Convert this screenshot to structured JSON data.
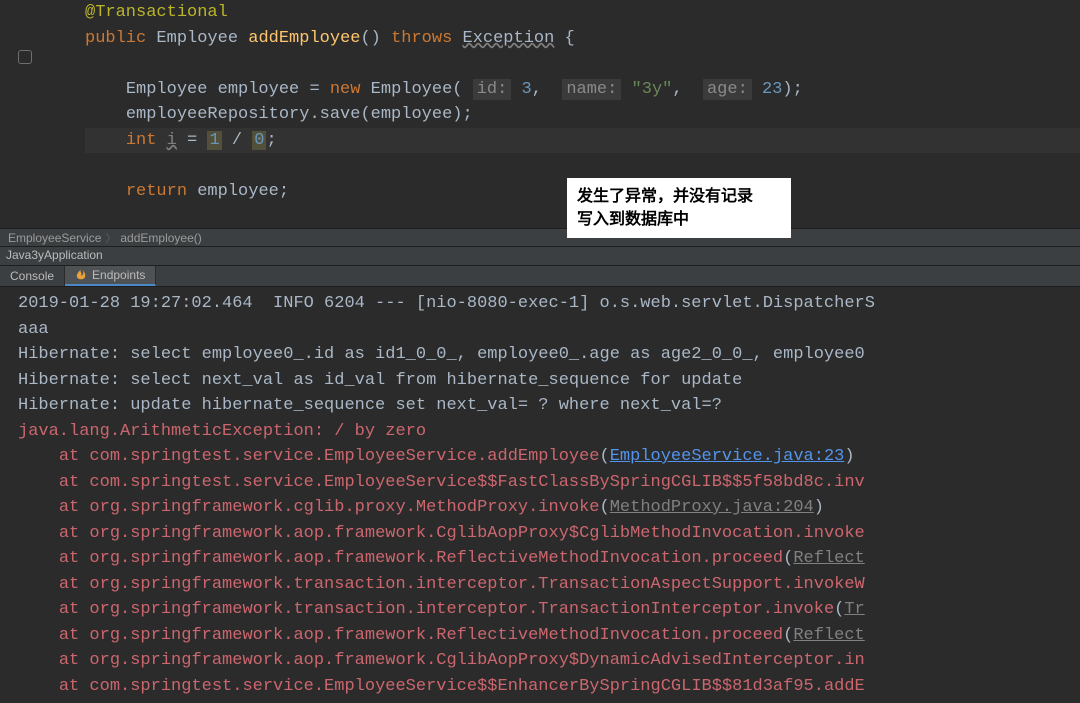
{
  "editor": {
    "annotation": "@Transactional",
    "kw_public": "public",
    "type_Employee": "Employee",
    "fn_name": "addEmployee",
    "kw_throws": "throws",
    "exc": "Exception",
    "decl_employee": "Employee employee = ",
    "kw_new": "new",
    "ctor": "Employee",
    "param_id": "id:",
    "arg_id": "3",
    "param_name": "name:",
    "arg_name": "\"3y\"",
    "param_age": "age:",
    "arg_age": "23",
    "repo_call": "employeeRepository.save(employee);",
    "int_kw": "int",
    "var_i": "i",
    "eq": " = ",
    "one": "1",
    "slash": " / ",
    "zero": "0",
    "semi": ";",
    "kw_return": "return",
    "ret_val": " employee;"
  },
  "breadcrumb": {
    "a": "EmployeeService",
    "b": "addEmployee()"
  },
  "run_title": "Java3yApplication",
  "tabs": {
    "console": "Console",
    "endpoints": "Endpoints"
  },
  "callout": {
    "l1": "发生了异常，并没有记录",
    "l2": "写入到数据库中"
  },
  "console": {
    "l0": "2019-01-28 19:27:02.464  INFO 6204 --- [nio-8080-exec-1] o.s.web.servlet.DispatcherS",
    "l1": "aaa",
    "l2": "Hibernate: select employee0_.id as id1_0_0_, employee0_.age as age2_0_0_, employee0",
    "l3": "Hibernate: select next_val as id_val from hibernate_sequence for update",
    "l4": "Hibernate: update hibernate_sequence set next_val= ? where next_val=?",
    "err": "java.lang.ArithmeticException: / by zero",
    "at": "at",
    "f1a": "com.springtest.service.EmployeeService.addEmployee",
    "f1b": "EmployeeService.java:23",
    "f2": "com.springtest.service.EmployeeService$$FastClassBySpringCGLIB$$5f58bd8c.inv",
    "f3a": "org.springframework.cglib.proxy.MethodProxy.invoke",
    "f3b": "MethodProxy.java:204",
    "f4": "org.springframework.aop.framework.CglibAopProxy$CglibMethodInvocation.invoke",
    "f5a": "org.springframework.aop.framework.ReflectiveMethodInvocation.proceed",
    "f5b": "Reflect",
    "f6": "org.springframework.transaction.interceptor.TransactionAspectSupport.invokeW",
    "f7a": "org.springframework.transaction.interceptor.TransactionInterceptor.invoke",
    "f7b": "Tr",
    "f8a": "org.springframework.aop.framework.ReflectiveMethodInvocation.proceed",
    "f8b": "Reflect",
    "f9": "org.springframework.aop.framework.CglibAopProxy$DynamicAdvisedInterceptor.in",
    "f10": "com.springtest.service.EmployeeService$$EnhancerBySpringCGLIB$$81d3af95.addE"
  }
}
